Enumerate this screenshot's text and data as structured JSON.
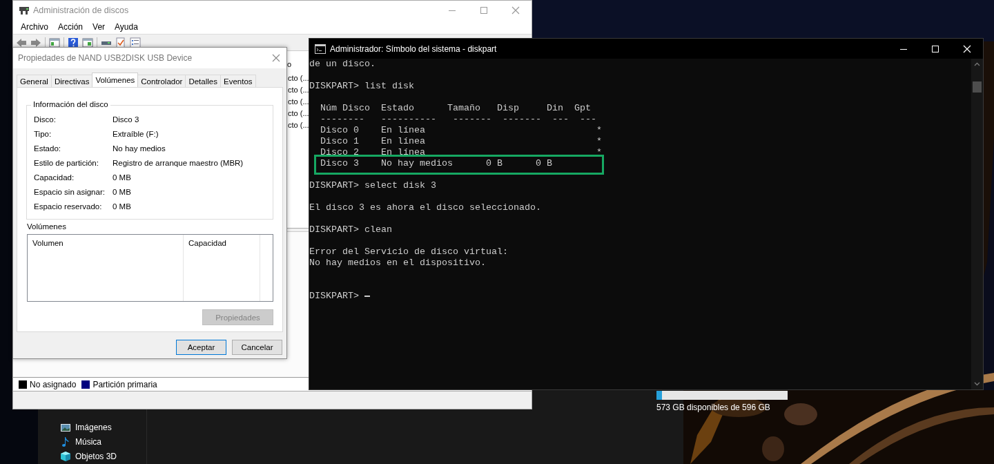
{
  "disk_management": {
    "title": "Administración de discos",
    "menu": [
      "Archivo",
      "Acción",
      "Ver",
      "Ayuda"
    ],
    "list_header": "o",
    "list_rows": [
      "cto (...",
      "cto (...",
      "cto (...",
      "cto (...",
      "cto (..."
    ],
    "legend": [
      {
        "label": "No asignado",
        "color": "#000000"
      },
      {
        "label": "Partición primaria",
        "color": "#000080"
      }
    ]
  },
  "properties_dialog": {
    "title": "Propiedades de NAND USB2DISK USB Device",
    "tabs": [
      {
        "label": "General",
        "selected": false
      },
      {
        "label": "Directivas",
        "selected": false
      },
      {
        "label": "Volúmenes",
        "selected": true
      },
      {
        "label": "Controlador",
        "selected": false
      },
      {
        "label": "Detalles",
        "selected": false
      },
      {
        "label": "Eventos",
        "selected": false
      }
    ],
    "group_title": "Información del disco",
    "fields": [
      {
        "label": "Disco:",
        "value": "Disco 3"
      },
      {
        "label": "Tipo:",
        "value": "Extraíble (F:)"
      },
      {
        "label": "Estado:",
        "value": "No hay medios"
      },
      {
        "label": "Estilo de partición:",
        "value": "Registro de arranque maestro (MBR)"
      },
      {
        "label": "Capacidad:",
        "value": "0 MB"
      },
      {
        "label": "Espacio sin asignar:",
        "value": "0 MB"
      },
      {
        "label": "Espacio reservado:",
        "value": "0 MB"
      }
    ],
    "volumes_label": "Volúmenes",
    "volumes_columns": [
      "Volumen",
      "Capacidad"
    ],
    "properties_button": {
      "label": "Propiedades",
      "disabled": true
    },
    "buttons": [
      "Aceptar",
      "Cancelar"
    ]
  },
  "console": {
    "title": "Administrador: Símbolo del sistema - diskpart",
    "lines": [
      {
        "kind": "text",
        "text": "de un disco.",
        "highlighted": false
      },
      {
        "kind": "blank"
      },
      {
        "kind": "text",
        "text": "DISKPART> list disk",
        "highlighted": false
      },
      {
        "kind": "blank"
      },
      {
        "kind": "text",
        "text": "  Núm Disco  Estado      Tamaño   Disp     Din  Gpt",
        "highlighted": false
      },
      {
        "kind": "text",
        "text": "  --------   ----------   -------  -------  ---  ---",
        "highlighted": false
      },
      {
        "kind": "text",
        "text": "  Disco 0    En línea                               *",
        "highlighted": false
      },
      {
        "kind": "text",
        "text": "  Disco 1    En línea                               *",
        "highlighted": false
      },
      {
        "kind": "text",
        "text": "  Disco 2    En línea                               *",
        "highlighted": false
      },
      {
        "kind": "text",
        "text": "  Disco 3    No hay medios      0 B      0 B",
        "highlighted": true
      },
      {
        "kind": "blank"
      },
      {
        "kind": "text",
        "text": "DISKPART> select disk 3",
        "highlighted": false
      },
      {
        "kind": "blank"
      },
      {
        "kind": "text",
        "text": "El disco 3 es ahora el disco seleccionado.",
        "highlighted": false
      },
      {
        "kind": "blank"
      },
      {
        "kind": "text",
        "text": "DISKPART> clean",
        "highlighted": false
      },
      {
        "kind": "blank"
      },
      {
        "kind": "text",
        "text": "Error del Servicio de disco virtual:",
        "highlighted": false
      },
      {
        "kind": "text",
        "text": "No hay medios en el dispositivo.",
        "highlighted": false
      },
      {
        "kind": "blank"
      },
      {
        "kind": "blank"
      },
      {
        "kind": "prompt",
        "text": "DISKPART>",
        "highlighted": false
      }
    ]
  },
  "explorer": {
    "nav_items": [
      {
        "kind": "pictures",
        "label": "Imágenes"
      },
      {
        "kind": "music",
        "label": "Música"
      },
      {
        "kind": "objects",
        "label": "Objetos 3D"
      }
    ],
    "drive": {
      "level": 0.04,
      "caption": "573 GB disponibles de 596 GB"
    }
  }
}
